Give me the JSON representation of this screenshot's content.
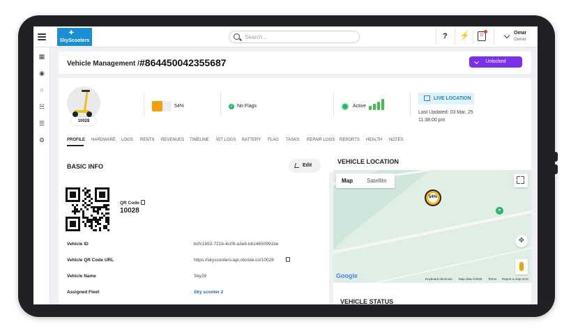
{
  "topbar": {
    "logo_text": "SkyScooters",
    "search_placeholder": "Search...",
    "help_icon": "question-icon",
    "user": {
      "name": "Omar",
      "role": "Owner"
    }
  },
  "sidebar": {
    "items": [
      "map-icon",
      "bicycle-icon",
      "scooter-icon",
      "hierarchy-icon",
      "layers-icon",
      "gear-icon"
    ]
  },
  "header": {
    "section": "Vehicle Management /",
    "vehicle_id": "#864450042355687",
    "status_button": "Unlocked"
  },
  "overview": {
    "scooter_tag": "10028",
    "battery_pct": "54%",
    "battery_level": 0.54,
    "flags": "No Flags",
    "status": "Active",
    "signal_bars": 4,
    "live_location": "LIVE LOCATION",
    "last_updated_label": "Last Updated: 03 Mar, 25",
    "last_updated_time": "11:38:00 pm"
  },
  "tabs": [
    "PROFILE",
    "HARDWARE",
    "LOGS",
    "RENTS",
    "REVENUES",
    "TIMELINE",
    "IOT LOGS",
    "BATTERY",
    "FLAG",
    "TASKS",
    "REPAIR LOGS",
    "REPORTS",
    "HEALTH",
    "NOTES"
  ],
  "basic_info": {
    "title": "BASIC INFO",
    "edit_label": "Edit",
    "qr_label": "QR Code",
    "qr_value": "10028",
    "rows": [
      {
        "label": "Vehicle ID",
        "value": "bcfc1b52-721b-4c09-a3e8-bb14650991be"
      },
      {
        "label": "Vehicle QR Code URL",
        "value": "https://skyscooters-api.otoride.co/10028"
      },
      {
        "label": "Vehicle Name",
        "value": "Sky28"
      },
      {
        "label": "Assigned Fleet",
        "value": "Sky scooter 2"
      }
    ]
  },
  "location": {
    "title": "VEHICLE LOCATION",
    "map_btn": "Map",
    "satellite_btn": "Satellite",
    "pin_label": "54%",
    "google": "Google",
    "attrib": [
      "Keyboard shortcuts",
      "Map data ©2025",
      "Terms",
      "Report a map error"
    ]
  },
  "status": {
    "title": "VEHICLE STATUS"
  }
}
